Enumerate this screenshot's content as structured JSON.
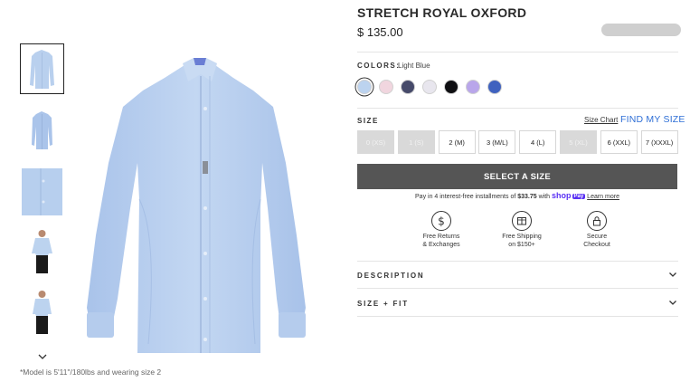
{
  "product": {
    "title": "STRETCH ROYAL OXFORD",
    "price": "$ 135.00"
  },
  "thumbnails": [
    {
      "name": "shirt-front"
    },
    {
      "name": "shirt-folded"
    },
    {
      "name": "fabric-detail"
    },
    {
      "name": "model-front"
    },
    {
      "name": "model-angle"
    }
  ],
  "model_note": "*Model is 5'11\"/180lbs and wearing size 2",
  "colors": {
    "label": "COLORS:",
    "selected": "Light Blue",
    "swatches": [
      {
        "color": "#bcd3ef",
        "selected": true
      },
      {
        "color": "#f1d6df",
        "selected": false
      },
      {
        "color": "#464a6a",
        "selected": false
      },
      {
        "color": "#e8e6ee",
        "selected": false
      },
      {
        "color": "#0f0f12",
        "selected": false
      },
      {
        "color": "#b9a6ea",
        "selected": false
      },
      {
        "color": "#3f62bf",
        "selected": false
      }
    ]
  },
  "size": {
    "label": "SIZE",
    "chart_link": "Size Chart",
    "find_link": "FIND MY SIZE",
    "options": [
      {
        "label": "0 (XS)",
        "available": false
      },
      {
        "label": "1 (S)",
        "available": false
      },
      {
        "label": "2 (M)",
        "available": true
      },
      {
        "label": "3 (M/L)",
        "available": true
      },
      {
        "label": "4 (L)",
        "available": true
      },
      {
        "label": "5 (XL)",
        "available": false
      },
      {
        "label": "6 (XXL)",
        "available": true
      },
      {
        "label": "7 (XXXL)",
        "available": true
      }
    ]
  },
  "cta": {
    "label": "SELECT A SIZE"
  },
  "installments": {
    "prefix": "Pay in 4 interest-free installments of",
    "amount": "$33.75",
    "with": "with",
    "shop": "shop",
    "pay": "Pay",
    "learn_more": "Learn more"
  },
  "features": [
    {
      "icon": "dollar-icon",
      "line1": "Free Returns",
      "line2": "& Exchanges"
    },
    {
      "icon": "box-icon",
      "line1": "Free Shipping",
      "line2": "on $150+"
    },
    {
      "icon": "lock-icon",
      "line1": "Secure",
      "line2": "Checkout"
    }
  ],
  "accordions": [
    {
      "label": "DESCRIPTION"
    },
    {
      "label": "SIZE + FIT"
    }
  ],
  "accent_colors": {
    "link_blue": "#2f6fd6",
    "shop_pay_purple": "#5a31f4",
    "cta_gray": "#555555"
  }
}
